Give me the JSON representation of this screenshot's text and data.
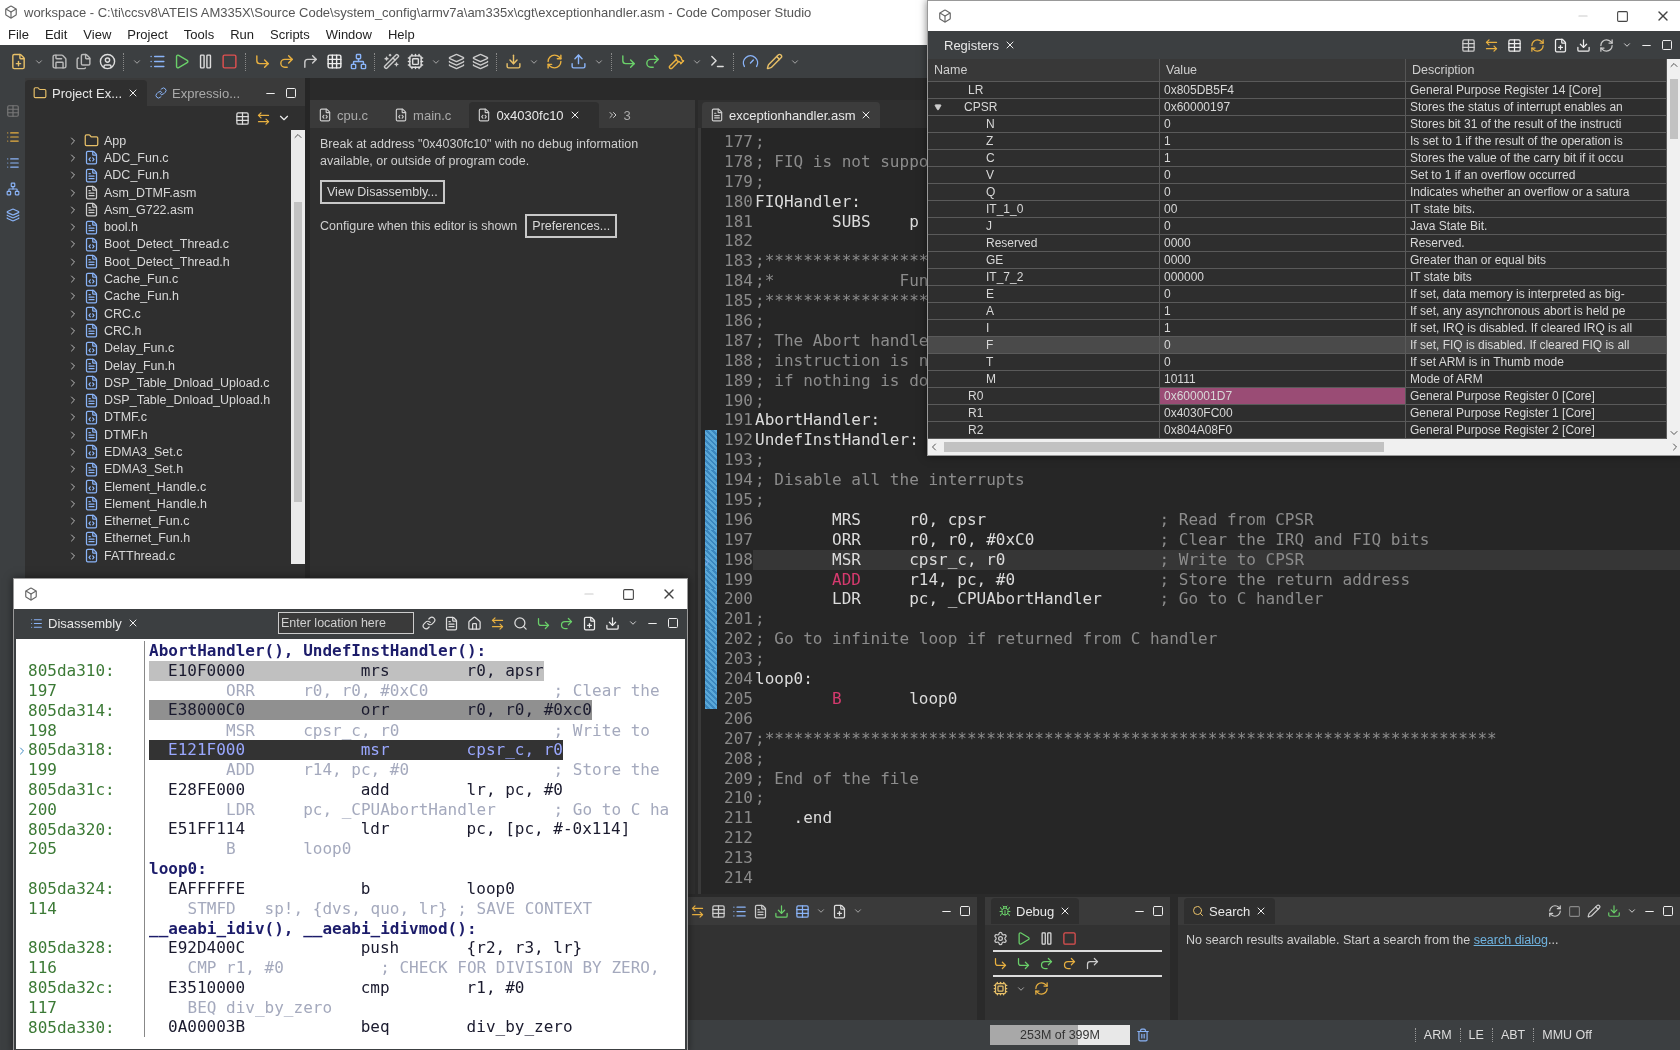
{
  "window": {
    "title": "workspace - C:\\ti\\ccsv8\\ATEIS AM335X\\Source Code\\system_config\\armv7a\\am335x\\cgt\\exceptionhandler.asm - Code Composer Studio"
  },
  "menu": [
    "File",
    "Edit",
    "View",
    "Project",
    "Tools",
    "Run",
    "Scripts",
    "Window",
    "Help"
  ],
  "project_explorer": {
    "tabs": [
      {
        "label": "Project Ex...",
        "selected": true
      },
      {
        "label": "Expressio...",
        "selected": false
      }
    ],
    "items": [
      {
        "name": "App",
        "kind": "folder",
        "expanded": false
      },
      {
        "name": "ADC_Fun.c",
        "kind": "c",
        "expanded": false
      },
      {
        "name": "ADC_Fun.h",
        "kind": "h",
        "expanded": false
      },
      {
        "name": "Asm_DTMF.asm",
        "kind": "asm",
        "expanded": false
      },
      {
        "name": "Asm_G722.asm",
        "kind": "asm",
        "expanded": false
      },
      {
        "name": "bool.h",
        "kind": "h",
        "expanded": false
      },
      {
        "name": "Boot_Detect_Thread.c",
        "kind": "c",
        "expanded": false
      },
      {
        "name": "Boot_Detect_Thread.h",
        "kind": "h",
        "expanded": false
      },
      {
        "name": "Cache_Fun.c",
        "kind": "c",
        "expanded": false
      },
      {
        "name": "Cache_Fun.h",
        "kind": "h",
        "expanded": false
      },
      {
        "name": "CRC.c",
        "kind": "c",
        "expanded": false
      },
      {
        "name": "CRC.h",
        "kind": "h",
        "expanded": false
      },
      {
        "name": "Delay_Fun.c",
        "kind": "c",
        "expanded": false
      },
      {
        "name": "Delay_Fun.h",
        "kind": "h",
        "expanded": false
      },
      {
        "name": "DSP_Table_Dnload_Upload.c",
        "kind": "c",
        "expanded": false
      },
      {
        "name": "DSP_Table_Dnload_Upload.h",
        "kind": "h",
        "expanded": false
      },
      {
        "name": "DTMF.c",
        "kind": "c",
        "expanded": false
      },
      {
        "name": "DTMF.h",
        "kind": "h",
        "expanded": false
      },
      {
        "name": "EDMA3_Set.c",
        "kind": "c",
        "expanded": false
      },
      {
        "name": "EDMA3_Set.h",
        "kind": "h",
        "expanded": false
      },
      {
        "name": "Element_Handle.c",
        "kind": "c",
        "expanded": false
      },
      {
        "name": "Element_Handle.h",
        "kind": "h",
        "expanded": false
      },
      {
        "name": "Ethernet_Fun.c",
        "kind": "c",
        "expanded": false
      },
      {
        "name": "Ethernet_Fun.h",
        "kind": "h",
        "expanded": false
      },
      {
        "name": "FATThread.c",
        "kind": "c",
        "expanded": false
      }
    ]
  },
  "info_editor": {
    "tabs": [
      {
        "label": "cpu.c",
        "selected": false
      },
      {
        "label": "main.c",
        "selected": false
      },
      {
        "label": "0x4030fc10",
        "selected": true
      }
    ],
    "overflow_count": "3",
    "message": "Break at address \"0x4030fc10\" with no debug information available, or outside of program code.",
    "view_button": "View Disassembly...",
    "configure_label": "Configure when this editor is shown",
    "preferences_button": "Preferences..."
  },
  "source_editor": {
    "tab": {
      "label": "exceptionhandler.asm",
      "selected": true
    },
    "lines": [
      {
        "number": "177",
        "current": false,
        "marked": false,
        "segments": [
          {
            "text": ";",
            "kind": "comment"
          }
        ]
      },
      {
        "number": "178",
        "current": false,
        "marked": false,
        "segments": [
          {
            "text": "; FIQ is not suppo",
            "kind": "comment"
          }
        ]
      },
      {
        "number": "179",
        "current": false,
        "marked": false,
        "segments": [
          {
            "text": ";",
            "kind": "comment"
          }
        ]
      },
      {
        "number": "180",
        "current": false,
        "marked": false,
        "segments": [
          {
            "text": "FIQHandler:",
            "kind": "plain"
          }
        ]
      },
      {
        "number": "181",
        "current": false,
        "marked": false,
        "segments": [
          {
            "text": "        SUBS    p",
            "kind": "plain"
          }
        ]
      },
      {
        "number": "182",
        "current": false,
        "marked": false
      },
      {
        "number": "183",
        "current": false,
        "marked": false,
        "segments": [
          {
            "text": ";*****************",
            "kind": "comment"
          }
        ]
      },
      {
        "number": "184",
        "current": false,
        "marked": false,
        "segments": [
          {
            "text": ";*             Fun",
            "kind": "comment"
          }
        ]
      },
      {
        "number": "185",
        "current": false,
        "marked": false,
        "segments": [
          {
            "text": ";*****************",
            "kind": "comment"
          }
        ]
      },
      {
        "number": "186",
        "current": false,
        "marked": false,
        "segments": [
          {
            "text": ";",
            "kind": "comment"
          }
        ]
      },
      {
        "number": "187",
        "current": false,
        "marked": false,
        "segments": [
          {
            "text": "; The Abort handle",
            "kind": "comment"
          }
        ]
      },
      {
        "number": "188",
        "current": false,
        "marked": false,
        "segments": [
          {
            "text": "; instruction is n",
            "kind": "comment"
          }
        ]
      },
      {
        "number": "189",
        "current": false,
        "marked": false,
        "segments": [
          {
            "text": "; if nothing is do",
            "kind": "comment"
          }
        ]
      },
      {
        "number": "190",
        "current": false,
        "marked": false,
        "segments": [
          {
            "text": ";",
            "kind": "comment"
          }
        ]
      },
      {
        "number": "191",
        "current": false,
        "marked": false,
        "segments": [
          {
            "text": "AbortHandler:",
            "kind": "plain"
          }
        ]
      },
      {
        "number": "192",
        "current": false,
        "marked": true,
        "segments": [
          {
            "text": "UndefInstHandler:",
            "kind": "plain"
          }
        ]
      },
      {
        "number": "193",
        "current": false,
        "marked": true,
        "segments": [
          {
            "text": ";",
            "kind": "comment"
          }
        ]
      },
      {
        "number": "194",
        "current": false,
        "marked": true,
        "segments": [
          {
            "text": "; Disable all the interrupts",
            "kind": "comment"
          }
        ]
      },
      {
        "number": "195",
        "current": false,
        "marked": true,
        "segments": [
          {
            "text": ";",
            "kind": "comment"
          }
        ]
      },
      {
        "number": "196",
        "current": false,
        "marked": true,
        "segments": [
          {
            "text": "        MRS     r0, cpsr                  ",
            "kind": "plain"
          },
          {
            "text": "; Read from CPSR",
            "kind": "comment"
          }
        ]
      },
      {
        "number": "197",
        "current": false,
        "marked": true,
        "segments": [
          {
            "text": "        ORR     r0, r0, #0xC0             ",
            "kind": "plain"
          },
          {
            "text": "; Clear the IRQ and FIQ bits",
            "kind": "comment"
          }
        ]
      },
      {
        "number": "198",
        "current": true,
        "marked": true,
        "segments": [
          {
            "text": "        MSR     cpsr_c, r0                ",
            "kind": "plain"
          },
          {
            "text": "; Write to CPSR",
            "kind": "comment"
          }
        ]
      },
      {
        "number": "199",
        "current": false,
        "marked": true,
        "segments": [
          {
            "text": "        ADD",
            "kind": "keyword"
          },
          {
            "text": "     r14, pc, #0               ",
            "kind": "plain"
          },
          {
            "text": "; Store the return address",
            "kind": "comment"
          }
        ]
      },
      {
        "number": "200",
        "current": false,
        "marked": true,
        "segments": [
          {
            "text": "        LDR     pc, _CPUAbortHandler      ",
            "kind": "plain"
          },
          {
            "text": "; Go to C handler",
            "kind": "comment"
          }
        ]
      },
      {
        "number": "201",
        "current": false,
        "marked": true,
        "segments": [
          {
            "text": ";",
            "kind": "comment"
          }
        ]
      },
      {
        "number": "202",
        "current": false,
        "marked": true,
        "segments": [
          {
            "text": "; Go to infinite loop if returned from C handler",
            "kind": "comment"
          }
        ]
      },
      {
        "number": "203",
        "current": false,
        "marked": true,
        "segments": [
          {
            "text": ";",
            "kind": "comment"
          }
        ]
      },
      {
        "number": "204",
        "current": false,
        "marked": true,
        "segments": [
          {
            "text": "loop0:",
            "kind": "plain"
          }
        ]
      },
      {
        "number": "205",
        "current": false,
        "marked": true,
        "segments": [
          {
            "text": "        B",
            "kind": "keyword"
          },
          {
            "text": "       loop0",
            "kind": "plain"
          }
        ]
      },
      {
        "number": "206",
        "current": false,
        "marked": false
      },
      {
        "number": "207",
        "current": false,
        "marked": false,
        "segments": [
          {
            "text": ";****************************************************************************",
            "kind": "comment"
          }
        ]
      },
      {
        "number": "208",
        "current": false,
        "marked": false,
        "segments": [
          {
            "text": ";",
            "kind": "comment"
          }
        ]
      },
      {
        "number": "209",
        "current": false,
        "marked": false,
        "segments": [
          {
            "text": "; End of the file",
            "kind": "comment"
          }
        ]
      },
      {
        "number": "210",
        "current": false,
        "marked": false,
        "segments": [
          {
            "text": ";",
            "kind": "comment"
          }
        ]
      },
      {
        "number": "211",
        "current": false,
        "marked": false,
        "segments": [
          {
            "text": "    .end",
            "kind": "plain"
          }
        ]
      },
      {
        "number": "212",
        "current": false,
        "marked": false
      },
      {
        "number": "213",
        "current": false,
        "marked": false
      },
      {
        "number": "214",
        "current": false,
        "marked": false
      }
    ]
  },
  "registers": {
    "tab": {
      "label": "Registers",
      "selected": true
    },
    "columns": [
      "Name",
      "Value",
      "Description"
    ],
    "rows": [
      {
        "name": "LR",
        "value": "0x805DB5F4",
        "description": "General Purpose Register 14 [Core]",
        "selected": false,
        "changed": false
      },
      {
        "name": "CPSR",
        "value": "0x60000197",
        "description": "Stores the status of interrupt enables an",
        "selected": false,
        "changed": false,
        "expanded": true,
        "children": [
          {
            "name": "N",
            "value": "0",
            "description": "Stores bit 31 of the result of the instructi",
            "selected": false,
            "changed": false
          },
          {
            "name": "Z",
            "value": "1",
            "description": "Is set to 1 if the result of the operation is",
            "selected": false,
            "changed": false
          },
          {
            "name": "C",
            "value": "1",
            "description": "Stores the value of the carry bit if it occu",
            "selected": false,
            "changed": false
          },
          {
            "name": "V",
            "value": "0",
            "description": "Set to 1 if an overflow occurred",
            "selected": false,
            "changed": false
          },
          {
            "name": "Q",
            "value": "0",
            "description": "Indicates whether an overflow or a satura",
            "selected": false,
            "changed": false
          },
          {
            "name": "IT_1_0",
            "value": "00",
            "description": "IT state bits.",
            "selected": false,
            "changed": false
          },
          {
            "name": "J",
            "value": "0",
            "description": "Java State Bit.",
            "selected": false,
            "changed": false
          },
          {
            "name": "Reserved",
            "value": "0000",
            "description": "Reserved.",
            "selected": false,
            "changed": false
          },
          {
            "name": "GE",
            "value": "0000",
            "description": "Greater than or equal bits",
            "selected": false,
            "changed": false
          },
          {
            "name": "IT_7_2",
            "value": "000000",
            "description": "IT state bits",
            "selected": false,
            "changed": false
          },
          {
            "name": "E",
            "value": "0",
            "description": "If set, data memory is interpreted as big-",
            "selected": false,
            "changed": false
          },
          {
            "name": "A",
            "value": "1",
            "description": "If set, any asynchronous abort is held pe",
            "selected": false,
            "changed": false
          },
          {
            "name": "I",
            "value": "1",
            "description": "If set, IRQ is disabled. If cleared IRQ is all",
            "selected": false,
            "changed": false
          },
          {
            "name": "F",
            "value": "0",
            "description": "If set, FIQ is disabled. If cleared FIQ is all",
            "selected": true,
            "changed": false
          },
          {
            "name": "T",
            "value": "0",
            "description": "If set ARM is in Thumb mode",
            "selected": false,
            "changed": false
          },
          {
            "name": "M",
            "value": "10111",
            "description": "Mode of ARM",
            "selected": false,
            "changed": false
          }
        ]
      },
      {
        "name": "R0",
        "value": "0x600001D7",
        "description": "General Purpose Register 0 [Core]",
        "selected": false,
        "changed": true
      },
      {
        "name": "R1",
        "value": "0x4030FC00",
        "description": "General Purpose Register 1 [Core]",
        "selected": false,
        "changed": false
      },
      {
        "name": "R2",
        "value": "0x804A08F0",
        "description": "General Purpose Register 2 [Core]",
        "selected": false,
        "changed": false
      }
    ]
  },
  "disassembly": {
    "tab": {
      "label": "Disassembly",
      "selected": true
    },
    "location": {
      "placeholder": "Enter location here"
    },
    "entries": [
      {
        "kind": "function",
        "text": "AbortHandler(), UndefInstHandler():"
      },
      {
        "kind": "instruction",
        "address": "805da310:",
        "opcode": "E10F0000",
        "mnemonic": "mrs",
        "operands": "r0, apsr",
        "current": false,
        "color": "#c0c0c0"
      },
      {
        "kind": "source",
        "line": "197",
        "text": "        ORR     r0, r0, #0xC0             ; Clear the"
      },
      {
        "kind": "instruction",
        "address": "805da314:",
        "opcode": "E38000C0",
        "mnemonic": "orr",
        "operands": "r0, r0, #0xc0",
        "current": false,
        "color": "#909090"
      },
      {
        "kind": "source",
        "line": "198",
        "text": "        MSR     cpsr_c, r0                ; Write to"
      },
      {
        "kind": "instruction",
        "address": "805da318:",
        "opcode": "E121F000",
        "mnemonic": "msr",
        "operands": "cpsr_c, r0",
        "current": true,
        "color": "#333333"
      },
      {
        "kind": "source",
        "line": "199",
        "text": "        ADD     r14, pc, #0               ; Store the"
      },
      {
        "kind": "instruction",
        "address": "805da31c:",
        "opcode": "E28FE000",
        "mnemonic": "add",
        "operands": "lr, pc, #0",
        "current": false
      },
      {
        "kind": "source",
        "line": "200",
        "text": "        LDR     pc, _CPUAbortHandler      ; Go to C ha"
      },
      {
        "kind": "instruction",
        "address": "805da320:",
        "opcode": "E51FF114",
        "mnemonic": "ldr",
        "operands": "pc, [pc, #-0x114]",
        "current": false
      },
      {
        "kind": "source",
        "line": "205",
        "text": "        B       loop0"
      },
      {
        "kind": "function",
        "text": "loop0:"
      },
      {
        "kind": "instruction",
        "address": "805da324:",
        "opcode": "EAFFFFFE",
        "mnemonic": "b",
        "operands": "loop0",
        "current": false
      },
      {
        "kind": "source",
        "line": "114",
        "text": "    STMFD   sp!, {dvs, quo, lr} ; SAVE CONTEXT"
      },
      {
        "kind": "function",
        "text": "__aeabi_idiv(), __aeabi_idivmod():"
      },
      {
        "kind": "instruction",
        "address": "805da328:",
        "opcode": "E92D400C",
        "mnemonic": "push",
        "operands": "{r2, r3, lr}",
        "current": false
      },
      {
        "kind": "source",
        "line": "116",
        "text": "    CMP r1, #0          ; CHECK FOR DIVISION BY ZERO,"
      },
      {
        "kind": "instruction",
        "address": "805da32c:",
        "opcode": "E3510000",
        "mnemonic": "cmp",
        "operands": "r1, #0",
        "current": false
      },
      {
        "kind": "source",
        "line": "117",
        "text": "    BEQ div_by_zero"
      },
      {
        "kind": "instruction",
        "address": "805da330:",
        "opcode": "0A00003B",
        "mnemonic": "beq",
        "operands": "div_by_zero",
        "current": false
      }
    ]
  },
  "debug": {
    "tab": {
      "label": "Debug",
      "selected": true
    }
  },
  "search": {
    "tab": {
      "label": "Search",
      "selected": true
    },
    "message": "No search results available. Start a search from the ",
    "link": "search dialog",
    "message_end": "..."
  },
  "status_bar": {
    "memory": {
      "text": "253M of 399M",
      "level": 0.63
    },
    "items": [
      "ARM",
      "LE",
      "ABT",
      "MMU Off"
    ]
  }
}
